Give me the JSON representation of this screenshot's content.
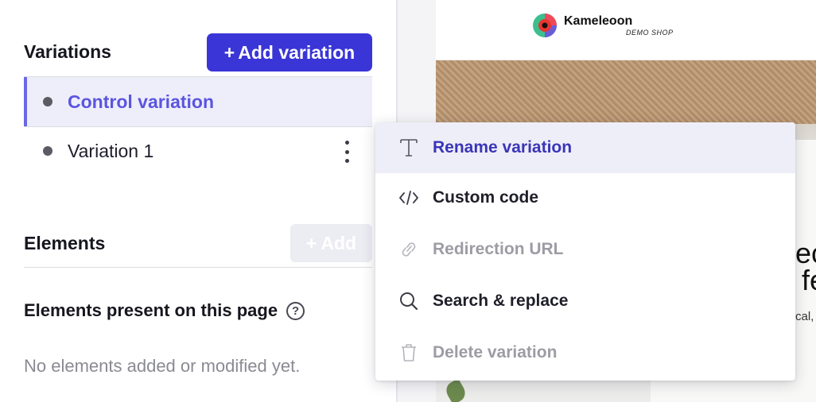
{
  "variations": {
    "title": "Variations",
    "add_button": "Add variation",
    "add_button_prefix": "+",
    "items": [
      {
        "label": "Control variation",
        "active": true
      },
      {
        "label": "Variation 1",
        "active": false
      }
    ]
  },
  "elements": {
    "title": "Elements",
    "add_button": "Add",
    "add_button_prefix": "+",
    "present_title": "Elements present on this page",
    "help_symbol": "?",
    "empty_text": "No elements added or modified yet."
  },
  "preview": {
    "brand_name": "Kameleoon",
    "brand_sub": "DEMO SHOP",
    "hero_fragment_1": "ec",
    "hero_fragment_2": "fe",
    "hero_fragment_3": "cal,"
  },
  "context_menu": {
    "items": [
      {
        "label": "Rename variation",
        "icon": "text-t-icon",
        "state": "hover"
      },
      {
        "label": "Custom code",
        "icon": "code-icon",
        "state": "enabled"
      },
      {
        "label": "Redirection URL",
        "icon": "link-icon",
        "state": "disabled"
      },
      {
        "label": "Search & replace",
        "icon": "search-icon",
        "state": "enabled"
      },
      {
        "label": "Delete variation",
        "icon": "trash-icon",
        "state": "disabled"
      }
    ]
  },
  "colors": {
    "primary": "#3a35d6",
    "active_text": "#5a55e0",
    "active_bg": "#eeeefb",
    "menu_hover_bg": "#eeeef8",
    "disabled_text": "#9c9ca4"
  }
}
